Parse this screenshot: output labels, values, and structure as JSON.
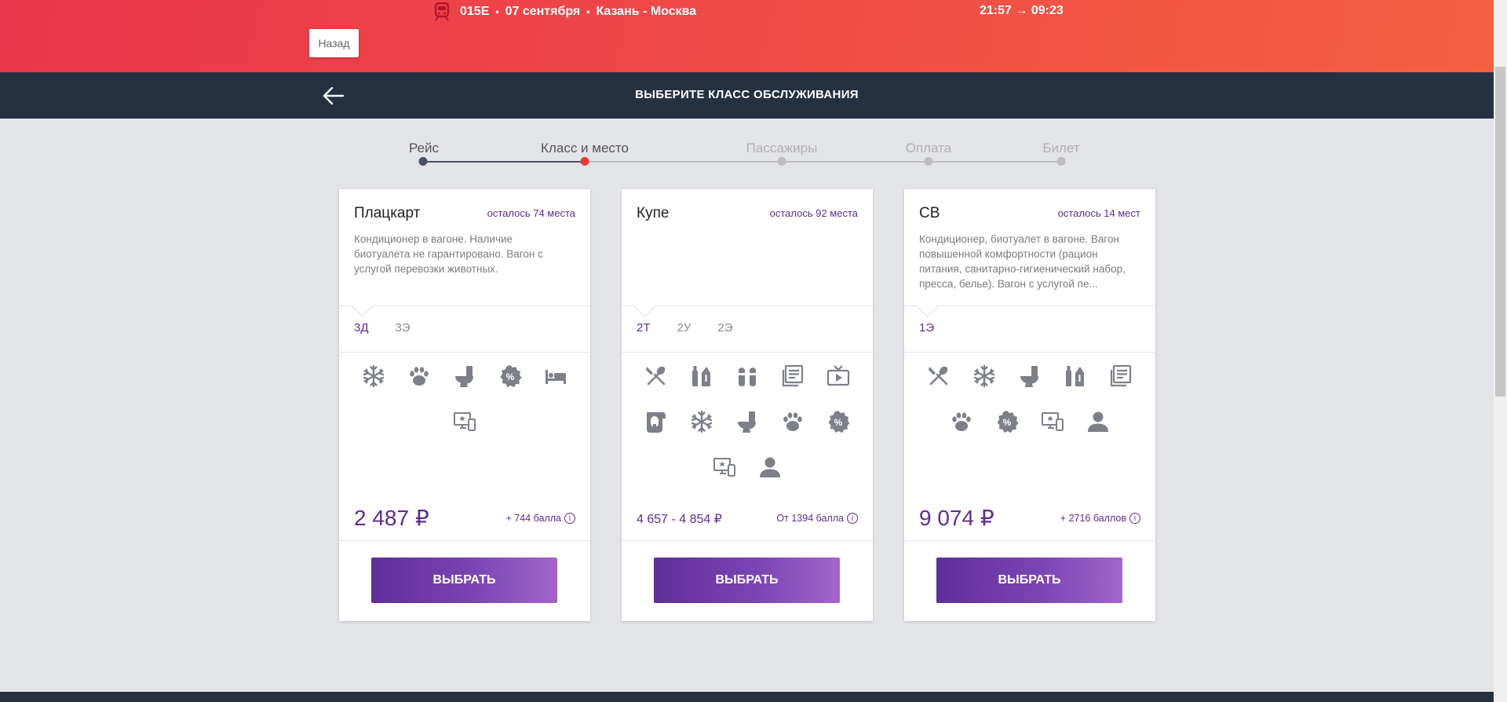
{
  "trip": {
    "train": "015Е",
    "date": "07 сентября",
    "route": "Казань - Москва",
    "time": "21:57 → 09:23"
  },
  "back_button": "Назад",
  "header": {
    "title": "ВЫБЕРИТЕ КЛАСС ОБСЛУЖИВАНИЯ"
  },
  "stepper": {
    "steps": [
      {
        "label": "Рейс",
        "state": "done"
      },
      {
        "label": "Класс и место",
        "state": "current"
      },
      {
        "label": "Пассажиры",
        "state": "future"
      },
      {
        "label": "Оплата",
        "state": "future"
      },
      {
        "label": "Билет",
        "state": "future"
      }
    ],
    "colors": {
      "done": "#4a5160",
      "current": "#e53d3d",
      "future": "#bdbdbd"
    }
  },
  "cards": [
    {
      "name": "Плацкарт",
      "seats_left": "осталось 74 места",
      "description": "Кондиционер в вагоне. Наличие биотуалета не гарантировано. Вагон с услугой перевозки животных.",
      "tabs": [
        "3Д",
        "3Э"
      ],
      "active_tab": 0,
      "amenities": [
        "snowflake-icon",
        "paw-icon",
        "toilet-icon",
        "discount-icon",
        "bed-icon",
        "entertainment-icon"
      ],
      "price": "2 487 ₽",
      "bonus": "+ 744 балла",
      "button": "ВЫБРАТЬ"
    },
    {
      "name": "Купе",
      "seats_left": "осталось 92 места",
      "description": "",
      "tabs": [
        "2Т",
        "2У",
        "2Э"
      ],
      "active_tab": 0,
      "amenities": [
        "cutlery-icon",
        "hygiene-kit-icon",
        "slippers-icon",
        "newspaper-icon",
        "tv-icon",
        "towel-icon",
        "snowflake-icon",
        "toilet-icon",
        "paw-icon",
        "discount-icon",
        "entertainment-icon",
        "person-icon"
      ],
      "price": "4 657 - 4 854 ₽",
      "bonus": "От 1394 балла",
      "button": "ВЫБРАТЬ"
    },
    {
      "name": "СВ",
      "seats_left": "осталось 14 мест",
      "description": "Кондиционер, биотуалет в вагоне. Вагон повышенной комфортности (рацион питания, санитарно-гигиенический набор, пресса, белье). Вагон с услугой пе...",
      "tabs": [
        "1Э"
      ],
      "active_tab": 0,
      "amenities": [
        "cutlery-icon",
        "snowflake-icon",
        "toilet-icon",
        "hygiene-kit-icon",
        "newspaper-icon",
        "paw-icon",
        "discount-icon",
        "entertainment-icon",
        "person-icon"
      ],
      "price": "9 074 ₽",
      "bonus": "+ 2716 баллов",
      "button": "ВЫБРАТЬ"
    }
  ],
  "colors": {
    "accent": "#5c2e91",
    "banner": "#ef4848",
    "header": "#263140",
    "icon": "#7d8089"
  }
}
